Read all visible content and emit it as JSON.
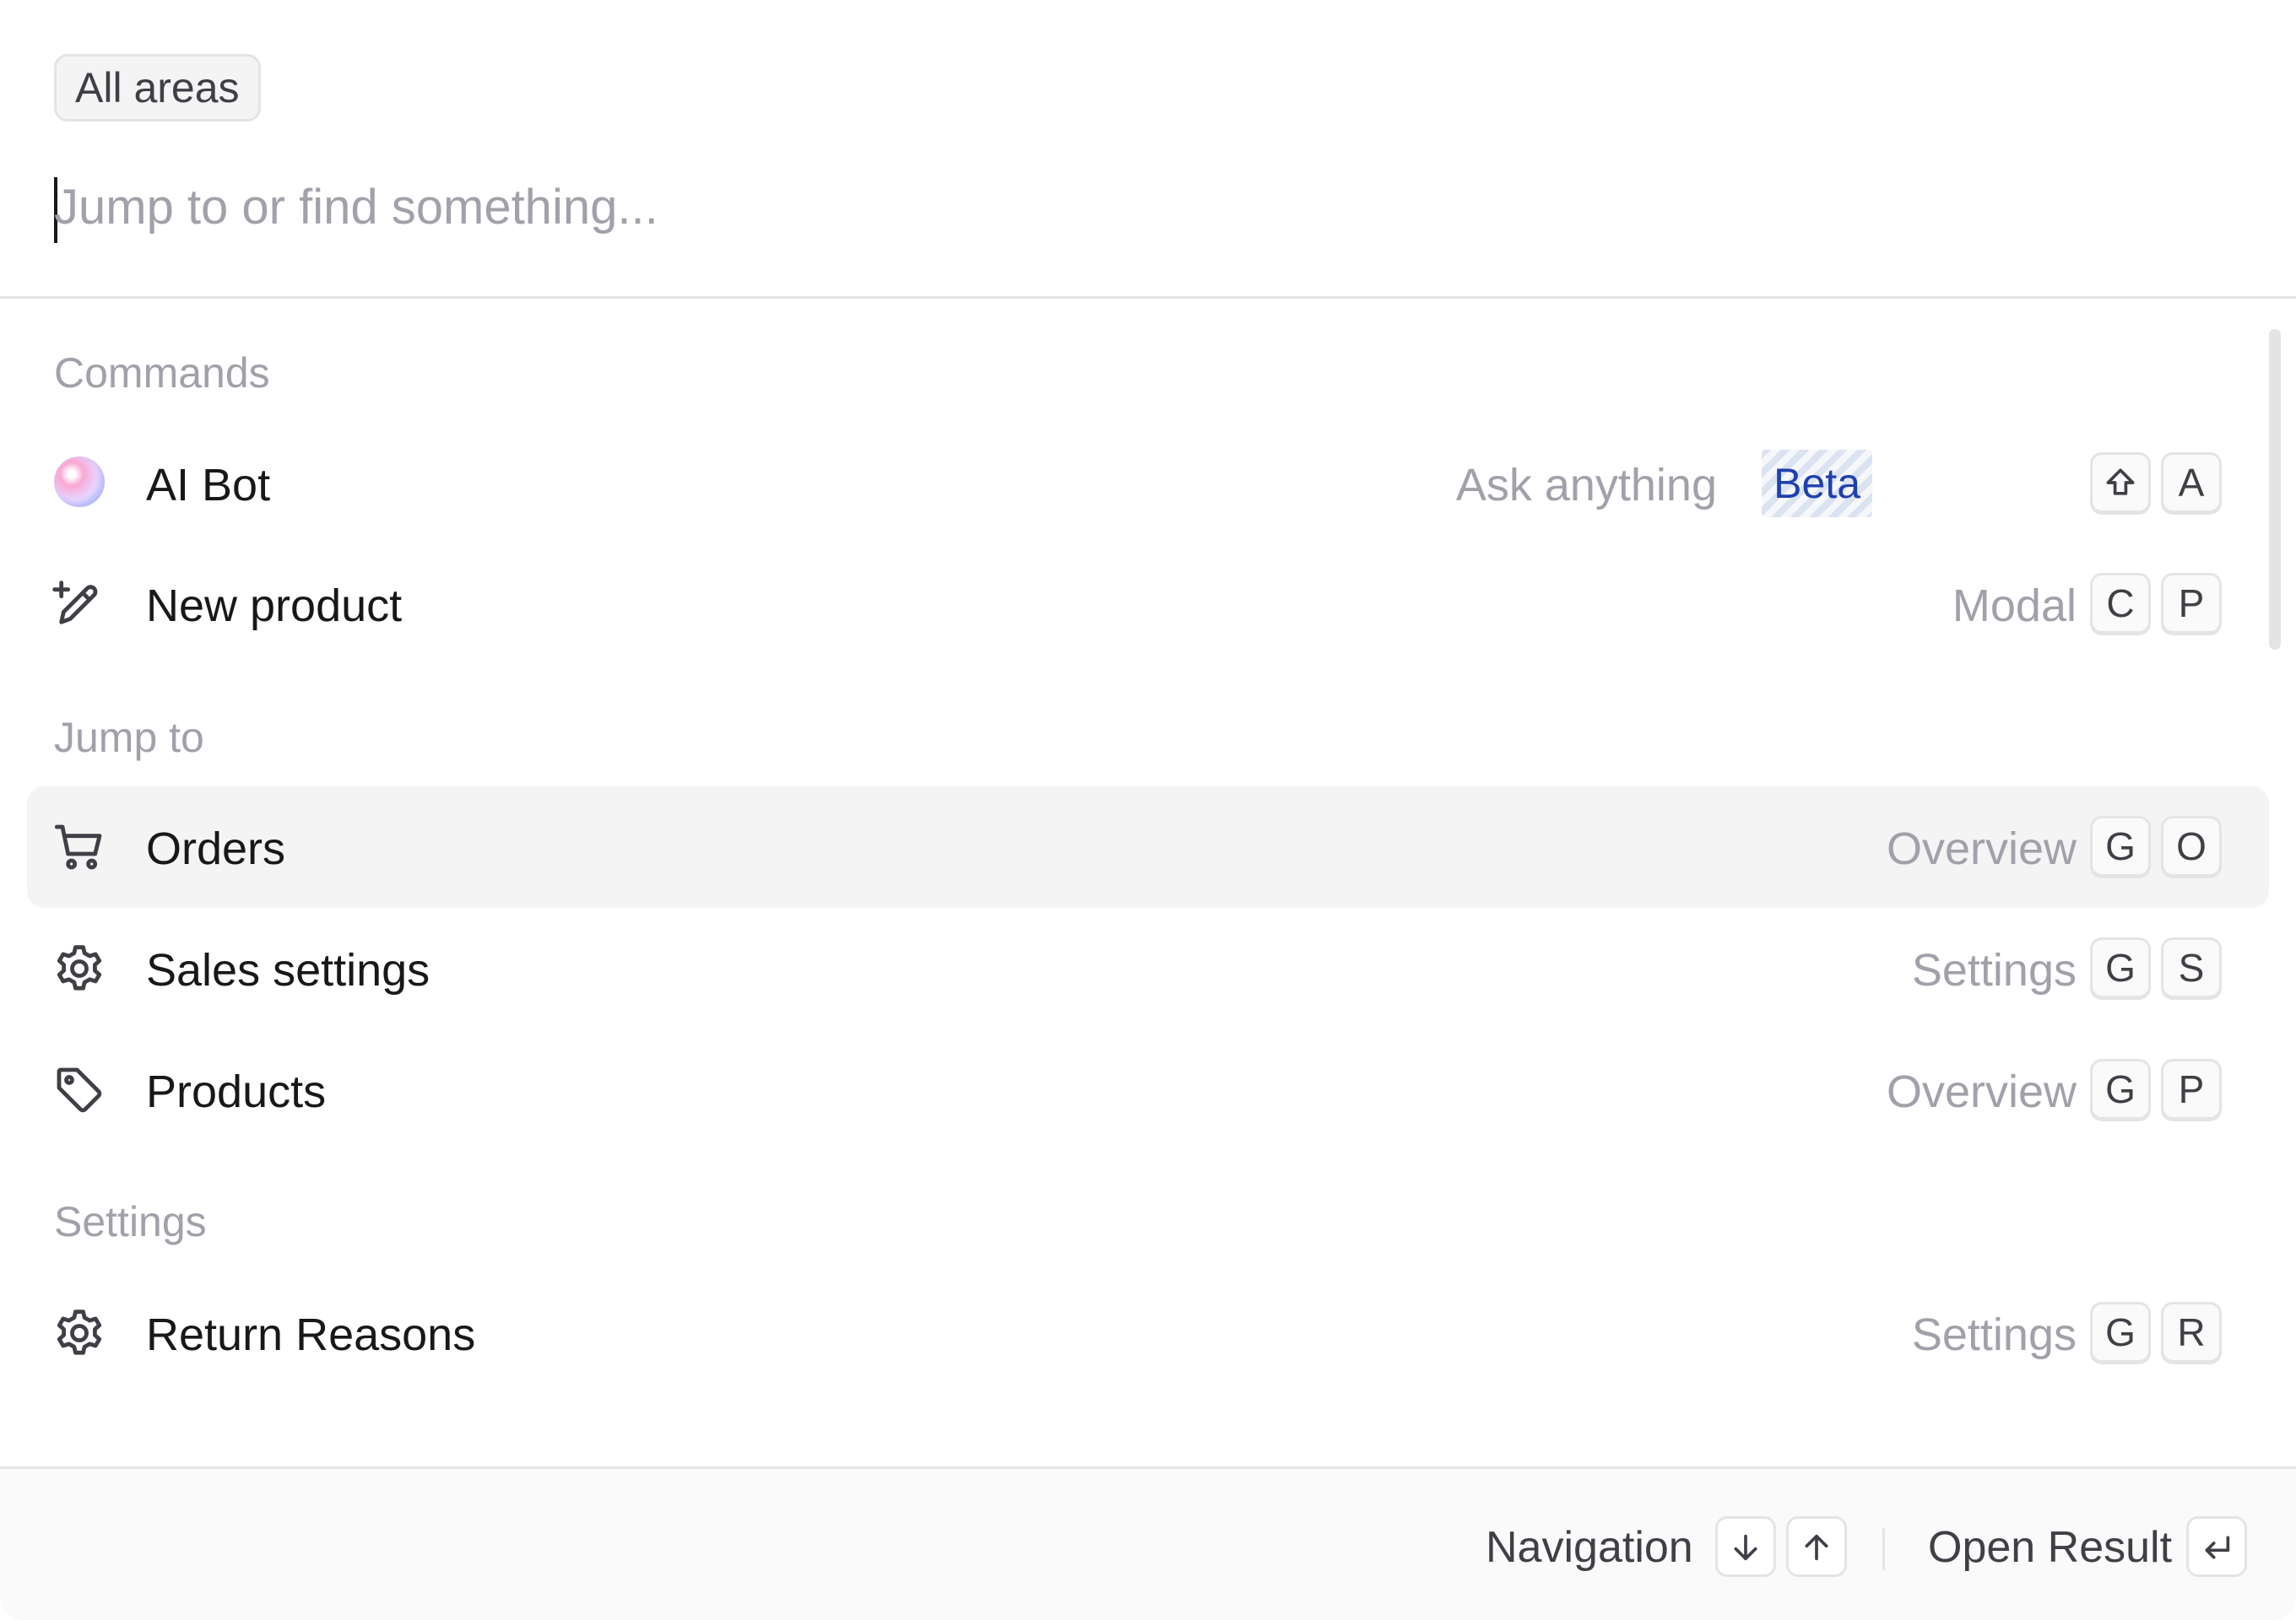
{
  "header": {
    "area_chip": "All areas",
    "search_placeholder": "Jump to or find something..."
  },
  "sections": {
    "commands": "Commands",
    "jump_to": "Jump to",
    "settings": "Settings"
  },
  "items": {
    "ai_bot": {
      "label": "AI Bot",
      "meta": "Ask anything",
      "badge": "Beta",
      "keys": [
        "⇧",
        "A"
      ]
    },
    "new_product": {
      "label": "New product",
      "meta": "Modal",
      "keys": [
        "C",
        "P"
      ]
    },
    "orders": {
      "label": "Orders",
      "meta": "Overview",
      "keys": [
        "G",
        "O"
      ]
    },
    "sales_settings": {
      "label": "Sales settings",
      "meta": "Settings",
      "keys": [
        "G",
        "S"
      ]
    },
    "products": {
      "label": "Products",
      "meta": "Overview",
      "keys": [
        "G",
        "P"
      ]
    },
    "return_reasons": {
      "label": "Return Reasons",
      "meta": "Settings",
      "keys": [
        "G",
        "R"
      ]
    }
  },
  "footer": {
    "navigation_label": "Navigation",
    "open_result_label": "Open Result"
  },
  "colors": {
    "active_row": "#f4f4f5",
    "beta_text": "#1e40af",
    "muted_text": "#a1a1aa"
  }
}
